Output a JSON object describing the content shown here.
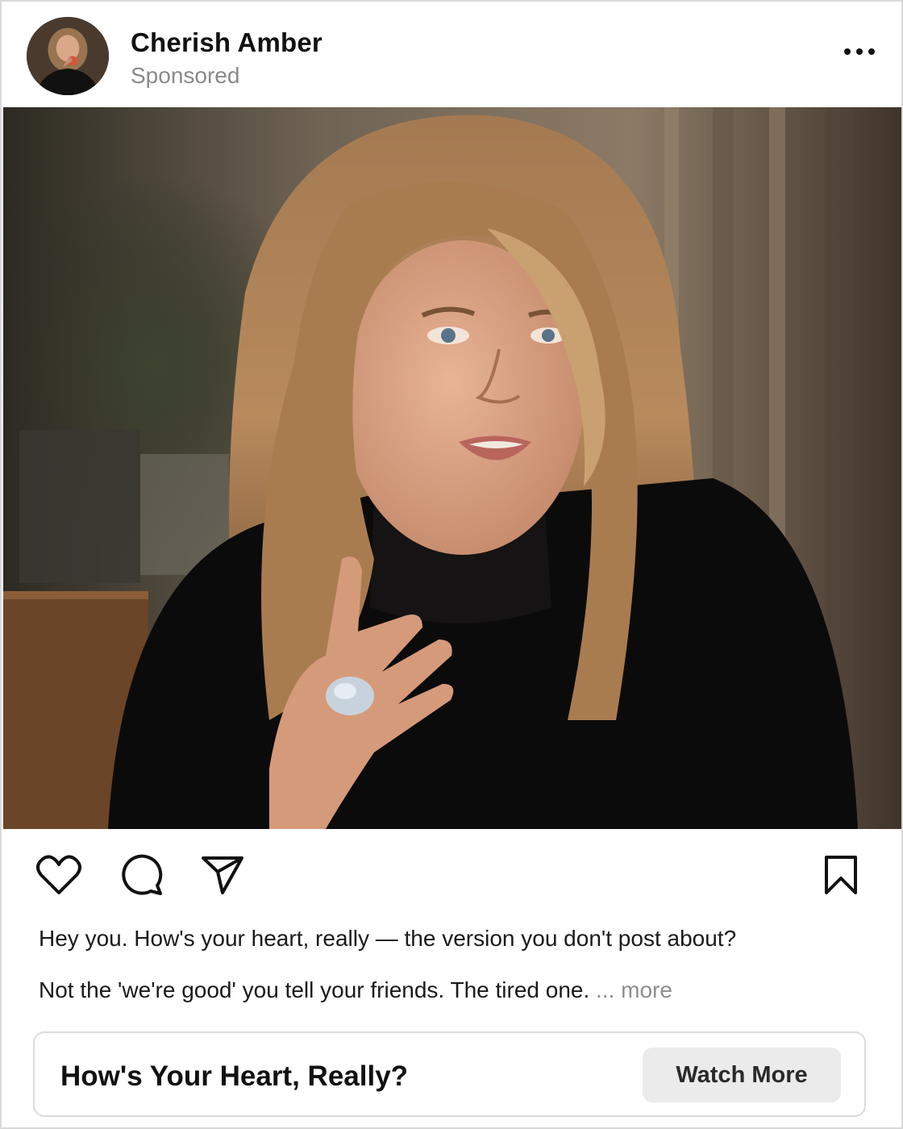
{
  "post": {
    "account_name": "Cherish Amber",
    "sponsored_label": "Sponsored",
    "caption_line_1": "Hey you. How's your heart, really — the version you don't post about?",
    "caption_line_2": "Not the 'we're good' you tell your friends. The tired one.",
    "more_label": "... more"
  },
  "icons": {
    "options": "more-options-icon",
    "like": "heart-icon",
    "comment": "comment-bubble-icon",
    "share": "paper-plane-icon",
    "save": "bookmark-icon"
  },
  "cta": {
    "headline": "How's Your Heart, Really?",
    "button_label": "Watch More"
  },
  "colors": {
    "cta_button_bg": "#ebebeb",
    "secondary_text": "#8a8a8a",
    "border": "#d9d9d9"
  }
}
